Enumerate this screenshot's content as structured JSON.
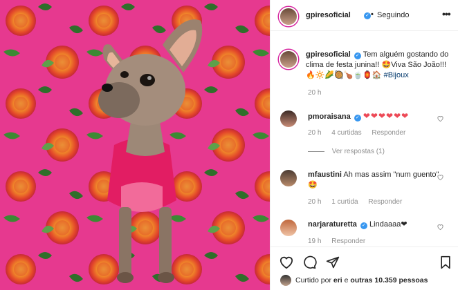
{
  "post": {
    "author": "gpiresoficial",
    "following_label": "Seguindo",
    "more_icon": "more-horizontal-icon",
    "caption": "Tem alguém gostando do clima de festa junina!! 🤩Viva São João!!!🔥🔆🌽🥘🍗🍵🏮🏠",
    "caption_tag": "#Bijoux",
    "caption_time": "20 h"
  },
  "comments": [
    {
      "user": "pmoraisana",
      "text": "❤❤❤❤❤❤",
      "time": "20 h",
      "likes": "4 curtidas",
      "reply": "Responder",
      "view_replies": "Ver respostas (1)"
    },
    {
      "user": "mfaustini",
      "text": "Ah mas assim \"num guento\" 🤩",
      "time": "20 h",
      "likes": "1 curtida",
      "reply": "Responder"
    },
    {
      "user": "narjaraturetta",
      "text": "Lindaaaa❤",
      "time": "19 h",
      "reply": "Responder"
    }
  ],
  "actions": {
    "liked_by_prefix": "Curtido por",
    "liked_by_user": "eri",
    "liked_by_middle": "e",
    "liked_by_count": "outras 10.359 pessoas"
  },
  "colors": {
    "accent": "#3897f0",
    "heart": "#ed4956",
    "link": "#00376b",
    "background_fabric": "#e13c8e"
  }
}
